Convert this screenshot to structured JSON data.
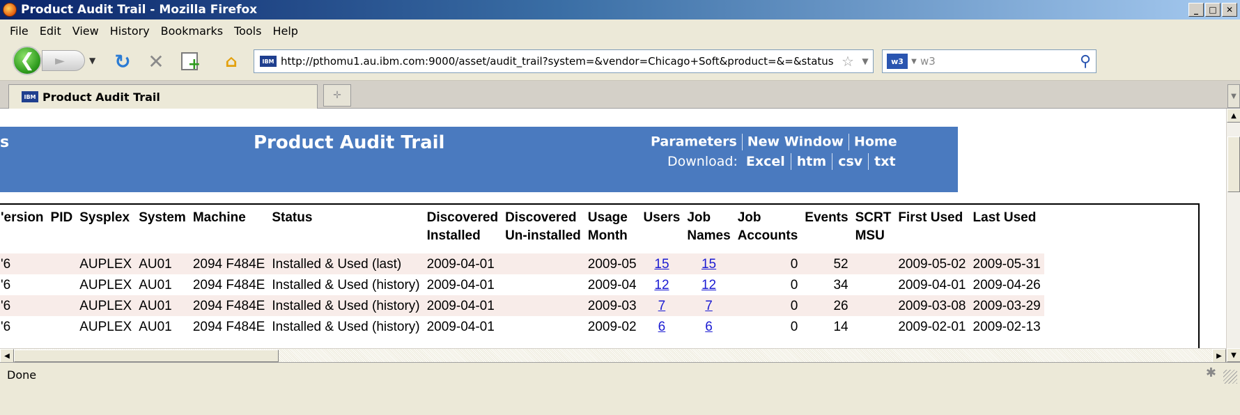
{
  "window": {
    "title": "Product Audit Trail - Mozilla Firefox"
  },
  "menu": [
    "File",
    "Edit",
    "View",
    "History",
    "Bookmarks",
    "Tools",
    "Help"
  ],
  "nav": {
    "url": "http://pthomu1.au.ibm.com:9000/asset/audit_trail?system=&vendor=Chicago+Soft&product=&=&status",
    "favicon_text": "IBM",
    "search_value": "w3",
    "search_engine_text": "w3"
  },
  "tab": {
    "label": "Product Audit Trail",
    "favicon_text": "IBM"
  },
  "banner": {
    "left_fragment": "s",
    "title": "Product Audit Trail",
    "links": [
      "Parameters",
      "New Window",
      "Home"
    ],
    "download_label": "Download:",
    "downloads": [
      "Excel",
      "htm",
      "csv",
      "txt"
    ]
  },
  "table": {
    "headers": [
      [
        "'ersion"
      ],
      [
        "PID"
      ],
      [
        "Sysplex"
      ],
      [
        "System"
      ],
      [
        "Machine"
      ],
      [
        "Status"
      ],
      [
        "Discovered",
        "Installed"
      ],
      [
        "Discovered",
        "Un-installed"
      ],
      [
        "Usage",
        "Month"
      ],
      [
        "Users"
      ],
      [
        "Job",
        "Names"
      ],
      [
        "Job",
        "Accounts"
      ],
      [
        "Events"
      ],
      [
        "SCRT",
        "MSU"
      ],
      [
        "First Used"
      ],
      [
        "Last Used"
      ]
    ],
    "rows": [
      [
        "'6",
        "",
        "AUPLEX",
        "AU01",
        "2094 F484E",
        "Installed & Used (last)",
        "2009-04-01",
        "",
        "2009-05",
        "15",
        "15",
        "0",
        "52",
        "",
        "2009-05-02",
        "2009-05-31"
      ],
      [
        "'6",
        "",
        "AUPLEX",
        "AU01",
        "2094 F484E",
        "Installed & Used (history)",
        "2009-04-01",
        "",
        "2009-04",
        "12",
        "12",
        "0",
        "34",
        "",
        "2009-04-01",
        "2009-04-26"
      ],
      [
        "'6",
        "",
        "AUPLEX",
        "AU01",
        "2094 F484E",
        "Installed & Used (history)",
        "2009-04-01",
        "",
        "2009-03",
        "7",
        "7",
        "0",
        "26",
        "",
        "2009-03-08",
        "2009-03-29"
      ],
      [
        "'6",
        "",
        "AUPLEX",
        "AU01",
        "2094 F484E",
        "Installed & Used (history)",
        "2009-04-01",
        "",
        "2009-02",
        "6",
        "6",
        "0",
        "14",
        "",
        "2009-02-01",
        "2009-02-13"
      ]
    ]
  },
  "status": {
    "text": "Done"
  },
  "colors": {
    "banner": "#4a7abf",
    "row_shade": "#f8ece9",
    "link": "#1a1ad2"
  }
}
